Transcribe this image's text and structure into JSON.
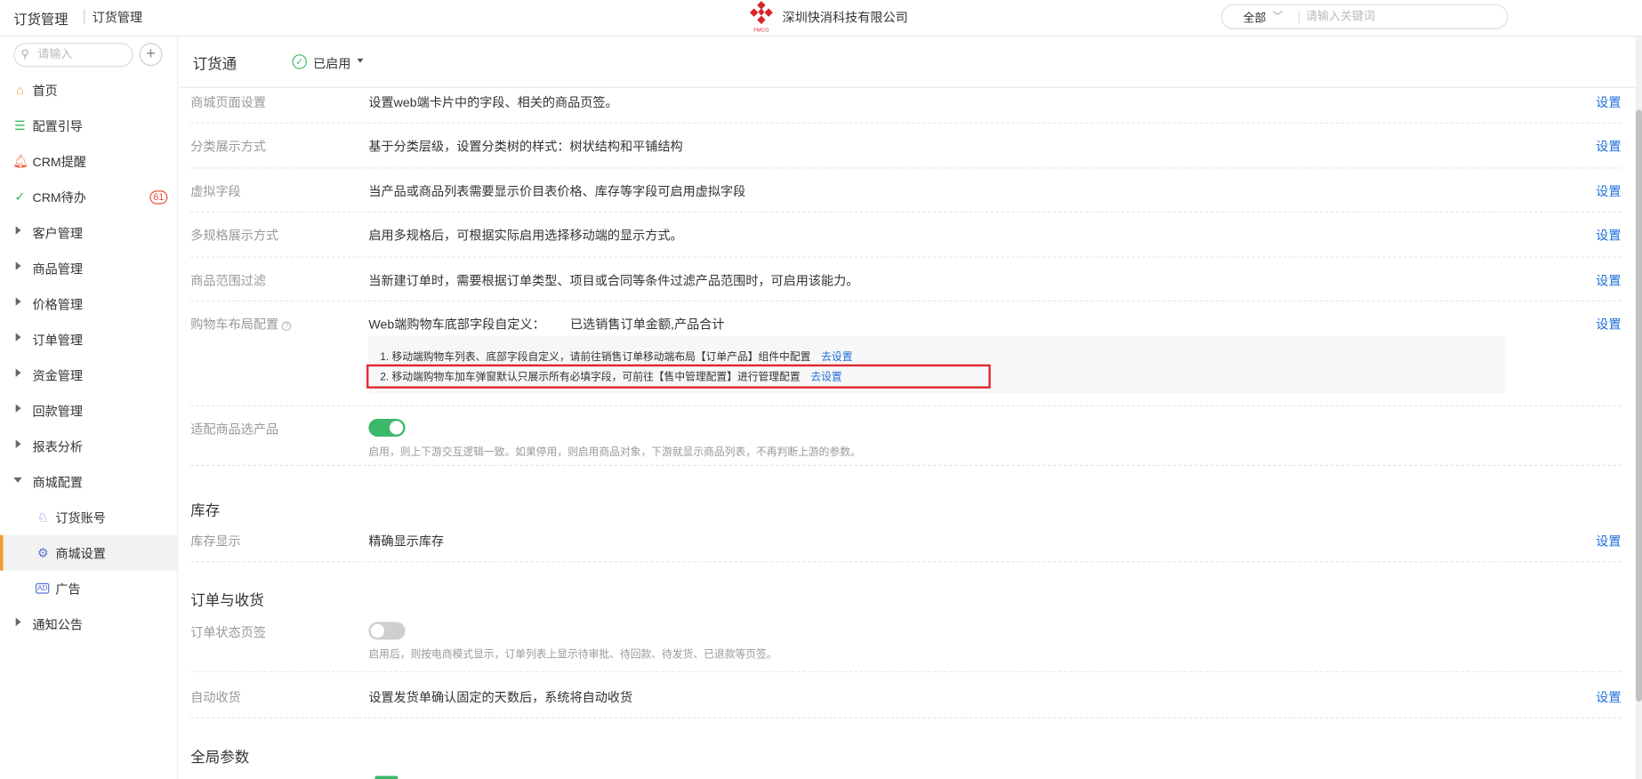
{
  "header": {
    "app_title": "订货管理",
    "breadcrumb": "订货管理",
    "company": "深圳快消科技有限公司",
    "logo_text": "FMCG",
    "search_scope": "全部",
    "search_placeholder": "请输入关键词"
  },
  "sidebar": {
    "search_placeholder": "请输入",
    "items": [
      {
        "label": "首页",
        "icon": "home-icon"
      },
      {
        "label": "配置引导",
        "icon": "guide-icon"
      },
      {
        "label": "CRM提醒",
        "icon": "bell-icon"
      },
      {
        "label": "CRM待办",
        "icon": "check-circle-icon",
        "badge": "61"
      },
      {
        "label": "客户管理"
      },
      {
        "label": "商品管理"
      },
      {
        "label": "价格管理"
      },
      {
        "label": "订单管理"
      },
      {
        "label": "资金管理"
      },
      {
        "label": "回款管理"
      },
      {
        "label": "报表分析"
      },
      {
        "label": "商城配置",
        "expanded": true
      },
      {
        "label": "订货账号",
        "icon": "account-icon"
      },
      {
        "label": "商城设置",
        "icon": "settings-icon",
        "active": true
      },
      {
        "label": "广告",
        "icon": "ad-icon",
        "icon_text": "AD"
      },
      {
        "label": "通知公告"
      }
    ]
  },
  "main": {
    "title": "订货通",
    "status": "已启用",
    "action_label": "设置",
    "rows": [
      {
        "label": "商城页面设置",
        "value": "设置web端卡片中的字段、相关的商品页签。"
      },
      {
        "label": "分类展示方式",
        "value": "基于分类层级，设置分类树的样式：树状结构和平铺结构"
      },
      {
        "label": "虚拟字段",
        "value": "当产品或商品列表需要显示价目表价格、库存等字段可启用虚拟字段"
      },
      {
        "label": "多规格展示方式",
        "value": "启用多规格后，可根据实际启用选择移动端的显示方式。"
      },
      {
        "label": "商品范围过滤",
        "value": "当新建订单时，需要根据订单类型、项目或合同等条件过滤产品范围时，可启用该能力。"
      }
    ],
    "cart": {
      "label": "购物车布局配置",
      "value_prefix": "Web端购物车底部字段自定义：",
      "value_selected": "已选销售订单金额,产品合计",
      "note1": "1. 移动端购物车列表、底部字段自定义，请前往销售订单移动端布局【订单产品】组件中配置",
      "note2": "2. 移动端购物车加车弹窗默认只展示所有必填字段，可前往【售中管理配置】进行管理配置",
      "link_label": "去设置"
    },
    "adapt": {
      "label": "适配商品选产品",
      "enabled": true,
      "hint": "启用，则上下游交互逻辑一致。如果停用，则启用商品对象，下游就显示商品列表，不再判断上游的参数。"
    },
    "inventory": {
      "section": "库存",
      "label": "库存显示",
      "value": "精确显示库存"
    },
    "order": {
      "section": "订单与收货",
      "tab_label": "订单状态页签",
      "tab_enabled": false,
      "tab_hint": "启用后，则按电商模式显示，订单列表上显示待审批、待回款、待发货、已退款等页签。",
      "auto_label": "自动收货",
      "auto_value": "设置发货单确认固定的天数后，系统将自动收货"
    },
    "global": {
      "section": "全局参数"
    }
  },
  "colors": {
    "accent_blue": "#1e6fd9",
    "active_orange": "#f39c33",
    "toggle_on": "#3cb86a",
    "highlight_red": "#e1252d"
  }
}
